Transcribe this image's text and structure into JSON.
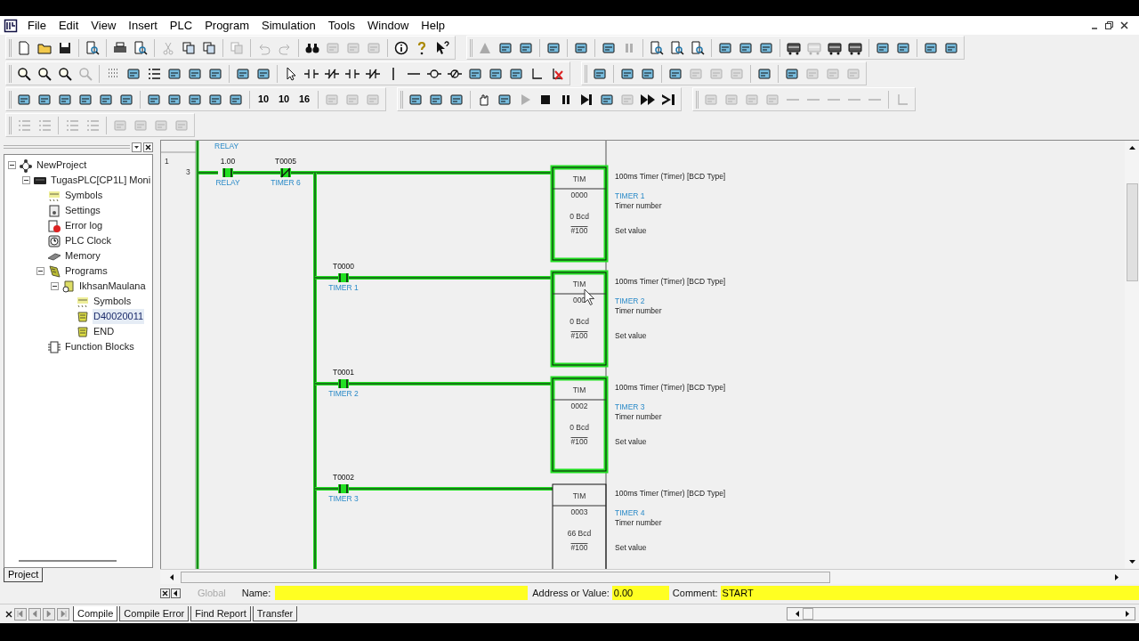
{
  "menu": [
    "File",
    "Edit",
    "View",
    "Insert",
    "PLC",
    "Program",
    "Simulation",
    "Tools",
    "Window",
    "Help"
  ],
  "toolbar_rows": [
    [
      [
        {
          "kind": "doc",
          "disabled": false
        },
        {
          "kind": "folder",
          "disabled": false
        },
        {
          "kind": "disk",
          "disabled": false
        },
        {
          "kind": "sep"
        },
        {
          "kind": "docview",
          "disabled": false
        },
        {
          "kind": "sep"
        },
        {
          "kind": "printer",
          "disabled": false
        },
        {
          "kind": "docview",
          "disabled": false
        },
        {
          "kind": "sep"
        },
        {
          "kind": "cut",
          "disabled": true
        },
        {
          "kind": "copy",
          "disabled": false
        },
        {
          "kind": "copy",
          "disabled": false
        },
        {
          "kind": "sep"
        },
        {
          "kind": "copy",
          "disabled": true
        },
        {
          "kind": "sep"
        },
        {
          "kind": "undo",
          "disabled": true
        },
        {
          "kind": "redo",
          "disabled": true
        },
        {
          "kind": "sep"
        },
        {
          "kind": "find",
          "disabled": false
        },
        {
          "kind": "block",
          "disabled": true
        },
        {
          "kind": "block",
          "disabled": true
        },
        {
          "kind": "block",
          "disabled": true
        },
        {
          "kind": "sep"
        },
        {
          "kind": "info",
          "disabled": false
        },
        {
          "kind": "help",
          "disabled": false
        },
        {
          "kind": "pointer",
          "disabled": false
        }
      ],
      [
        {
          "kind": "triangle",
          "disabled": true
        },
        {
          "kind": "block",
          "disabled": false
        },
        {
          "kind": "block",
          "disabled": false
        },
        {
          "kind": "sep"
        },
        {
          "kind": "block",
          "disabled": false
        },
        {
          "kind": "sep"
        },
        {
          "kind": "block",
          "disabled": false
        },
        {
          "kind": "sep"
        },
        {
          "kind": "block",
          "disabled": false
        },
        {
          "kind": "pause",
          "disabled": true
        },
        {
          "kind": "sep"
        },
        {
          "kind": "docview",
          "disabled": false
        },
        {
          "kind": "docview",
          "disabled": false
        },
        {
          "kind": "docview",
          "disabled": false
        },
        {
          "kind": "sep"
        },
        {
          "kind": "block",
          "disabled": false
        },
        {
          "kind": "block",
          "disabled": false
        },
        {
          "kind": "block",
          "disabled": false
        },
        {
          "kind": "sep"
        },
        {
          "kind": "rack",
          "disabled": false
        },
        {
          "kind": "rack",
          "disabled": true
        },
        {
          "kind": "rack",
          "disabled": false
        },
        {
          "kind": "rack",
          "disabled": false
        },
        {
          "kind": "sep"
        },
        {
          "kind": "block",
          "disabled": false
        },
        {
          "kind": "block",
          "disabled": false
        },
        {
          "kind": "sep"
        },
        {
          "kind": "block",
          "disabled": false
        },
        {
          "kind": "block",
          "disabled": false
        }
      ]
    ],
    [
      [
        {
          "kind": "zoom",
          "disabled": false
        },
        {
          "kind": "zoom",
          "disabled": false
        },
        {
          "kind": "zoom",
          "disabled": false
        },
        {
          "kind": "zoom",
          "disabled": true
        },
        {
          "kind": "sep"
        },
        {
          "kind": "grid",
          "disabled": false
        },
        {
          "kind": "block",
          "disabled": false
        },
        {
          "kind": "list",
          "disabled": false
        },
        {
          "kind": "block",
          "disabled": false
        },
        {
          "kind": "block",
          "disabled": false
        },
        {
          "kind": "block",
          "disabled": false
        },
        {
          "kind": "sep"
        },
        {
          "kind": "block",
          "disabled": false
        },
        {
          "kind": "block",
          "disabled": false
        },
        {
          "kind": "sep"
        },
        {
          "kind": "arrow",
          "disabled": false
        },
        {
          "kind": "contact",
          "disabled": false
        },
        {
          "kind": "nccontact",
          "disabled": false
        },
        {
          "kind": "contact",
          "disabled": false
        },
        {
          "kind": "nccontact",
          "disabled": false
        },
        {
          "kind": "vline",
          "disabled": false
        },
        {
          "kind": "hline",
          "disabled": false
        },
        {
          "kind": "coil",
          "disabled": false
        },
        {
          "kind": "nccoil",
          "disabled": false
        },
        {
          "kind": "block",
          "disabled": false
        },
        {
          "kind": "block",
          "disabled": false
        },
        {
          "kind": "block",
          "disabled": false
        },
        {
          "kind": "corner",
          "disabled": false
        },
        {
          "kind": "delete",
          "disabled": false
        }
      ],
      [
        {
          "kind": "block",
          "disabled": false
        },
        {
          "kind": "sep"
        },
        {
          "kind": "block",
          "disabled": false
        },
        {
          "kind": "block",
          "disabled": false
        },
        {
          "kind": "sep"
        },
        {
          "kind": "block",
          "disabled": false
        },
        {
          "kind": "block",
          "disabled": true
        },
        {
          "kind": "block",
          "disabled": true
        },
        {
          "kind": "block",
          "disabled": true
        },
        {
          "kind": "sep"
        },
        {
          "kind": "block",
          "disabled": false
        },
        {
          "kind": "sep"
        },
        {
          "kind": "block",
          "disabled": false
        },
        {
          "kind": "block",
          "disabled": true
        },
        {
          "kind": "block",
          "disabled": true
        },
        {
          "kind": "block",
          "disabled": true
        }
      ]
    ],
    [
      [
        {
          "kind": "block",
          "disabled": false
        },
        {
          "kind": "block",
          "disabled": false
        },
        {
          "kind": "block",
          "disabled": false
        },
        {
          "kind": "block",
          "disabled": false
        },
        {
          "kind": "block",
          "disabled": false
        },
        {
          "kind": "block",
          "disabled": false
        },
        {
          "kind": "sep"
        },
        {
          "kind": "block",
          "disabled": false
        },
        {
          "kind": "block",
          "disabled": false
        },
        {
          "kind": "block",
          "disabled": false
        },
        {
          "kind": "block",
          "disabled": false
        },
        {
          "kind": "block",
          "disabled": false
        },
        {
          "kind": "sep"
        },
        {
          "kind": "num",
          "label": "10",
          "disabled": false
        },
        {
          "kind": "num",
          "label": "10",
          "disabled": false
        },
        {
          "kind": "num",
          "label": "16",
          "disabled": false
        },
        {
          "kind": "sep"
        },
        {
          "kind": "block",
          "disabled": true
        },
        {
          "kind": "block",
          "disabled": true
        },
        {
          "kind": "block",
          "disabled": true
        }
      ],
      [
        {
          "kind": "block",
          "disabled": false
        },
        {
          "kind": "block",
          "disabled": false
        },
        {
          "kind": "block",
          "disabled": false
        },
        {
          "kind": "sep"
        },
        {
          "kind": "hand",
          "disabled": false
        },
        {
          "kind": "block",
          "disabled": false
        },
        {
          "kind": "play",
          "disabled": true
        },
        {
          "kind": "stop",
          "disabled": false
        },
        {
          "kind": "pause",
          "disabled": false
        },
        {
          "kind": "step",
          "disabled": false
        },
        {
          "kind": "block",
          "disabled": false
        },
        {
          "kind": "block",
          "disabled": true
        },
        {
          "kind": "ff",
          "disabled": false
        },
        {
          "kind": "end",
          "disabled": false
        }
      ],
      [
        {
          "kind": "block",
          "disabled": true
        },
        {
          "kind": "block",
          "disabled": true
        },
        {
          "kind": "block",
          "disabled": true
        },
        {
          "kind": "block",
          "disabled": true
        },
        {
          "kind": "hline",
          "disabled": true
        },
        {
          "kind": "hline",
          "disabled": true
        },
        {
          "kind": "hline",
          "disabled": true
        },
        {
          "kind": "hline",
          "disabled": true
        },
        {
          "kind": "hline",
          "disabled": true
        },
        {
          "kind": "sep"
        },
        {
          "kind": "corner",
          "disabled": true
        }
      ]
    ],
    [
      [
        {
          "kind": "list",
          "disabled": true
        },
        {
          "kind": "list",
          "disabled": true
        },
        {
          "kind": "sep"
        },
        {
          "kind": "list",
          "disabled": true
        },
        {
          "kind": "list",
          "disabled": true
        },
        {
          "kind": "sep"
        },
        {
          "kind": "block",
          "disabled": true
        },
        {
          "kind": "block",
          "disabled": true
        },
        {
          "kind": "block",
          "disabled": true
        },
        {
          "kind": "block",
          "disabled": true
        }
      ]
    ]
  ],
  "project_tree": [
    {
      "label": "NewProject",
      "kind": "project",
      "expanded": true,
      "selected": false,
      "children": [
        {
          "label": "TugasPLC[CP1L] Moni",
          "kind": "plc",
          "expanded": true,
          "selected": false,
          "children": [
            {
              "label": "Symbols",
              "kind": "symbols",
              "selected": false
            },
            {
              "label": "Settings",
              "kind": "settings",
              "selected": false
            },
            {
              "label": "Error log",
              "kind": "errorlog",
              "selected": false
            },
            {
              "label": "PLC Clock",
              "kind": "clock",
              "selected": false
            },
            {
              "label": "Memory",
              "kind": "memory",
              "selected": false
            },
            {
              "label": "Programs",
              "kind": "programs",
              "expanded": true,
              "selected": false,
              "children": [
                {
                  "label": "IkhsanMaulana",
                  "kind": "program",
                  "expanded": true,
                  "selected": false,
                  "children": [
                    {
                      "label": "Symbols",
                      "kind": "symbols",
                      "selected": false
                    },
                    {
                      "label": "D40020011",
                      "kind": "section",
                      "selected": true
                    },
                    {
                      "label": "END",
                      "kind": "section",
                      "selected": false
                    }
                  ]
                }
              ]
            },
            {
              "label": "Function Blocks",
              "kind": "fb",
              "selected": false
            }
          ]
        }
      ]
    }
  ],
  "project_tab": "Project",
  "ladder": {
    "top_comment": "RELAY",
    "rung_number": "1",
    "step_number": "3",
    "input_contacts": [
      {
        "address": "1.00",
        "comment": "RELAY",
        "kind": "no",
        "energized": true
      },
      {
        "address": "T0005",
        "comment": "TIMER 6",
        "kind": "nc",
        "energized": true
      }
    ],
    "branches": [
      {
        "timer": {
          "instruction": "TIM",
          "number": "0000",
          "present": "0 Bcd",
          "set": "#100",
          "description": "100ms Timer (Timer) [BCD Type]",
          "comment": "TIMER 1",
          "operand_1": "Timer number",
          "operand_2": "Set value",
          "energized": true
        }
      },
      {
        "contact": {
          "address": "T0000",
          "comment": "TIMER 1",
          "energized": true
        },
        "timer": {
          "instruction": "TIM",
          "number": "000",
          "present": "0 Bcd",
          "set": "#100",
          "description": "100ms Timer (Timer) [BCD Type]",
          "comment": "TIMER 2",
          "operand_1": "Timer number",
          "operand_2": "Set value",
          "energized": true
        }
      },
      {
        "contact": {
          "address": "T0001",
          "comment": "TIMER 2",
          "energized": true
        },
        "timer": {
          "instruction": "TIM",
          "number": "0002",
          "present": "0 Bcd",
          "set": "#100",
          "description": "100ms Timer (Timer) [BCD Type]",
          "comment": "TIMER 3",
          "operand_1": "Timer number",
          "operand_2": "Set value",
          "energized": true
        }
      },
      {
        "contact": {
          "address": "T0002",
          "comment": "TIMER 3",
          "energized": true
        },
        "timer": {
          "instruction": "TIM",
          "number": "0003",
          "present": "66 Bcd",
          "set": "#100",
          "description": "100ms Timer (Timer) [BCD Type]",
          "comment": "TIMER 4",
          "operand_1": "Timer number",
          "operand_2": "Set value",
          "energized": false
        }
      }
    ]
  },
  "info_bar": {
    "scope_tab": "Global",
    "name_label": "Name:",
    "address_label": "Address or Value:",
    "address_value": "0.00",
    "comment_label": "Comment:",
    "comment_value": "START"
  },
  "output_tabs": [
    {
      "label": "Compile",
      "selected": true
    },
    {
      "label": "Compile Error",
      "selected": false
    },
    {
      "label": "Find Report",
      "selected": false
    },
    {
      "label": "Transfer",
      "selected": false
    }
  ]
}
